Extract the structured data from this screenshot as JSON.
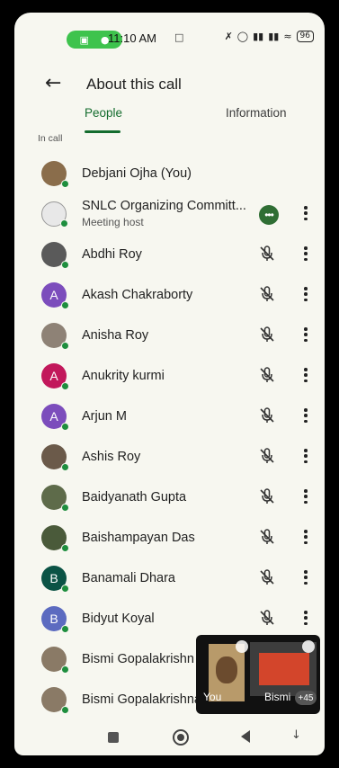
{
  "statusbar": {
    "time": "11:10 AM",
    "battery": "96",
    "recording_icons": [
      "camera-icon",
      "mic-icon"
    ]
  },
  "header": {
    "title": "About this call",
    "back_icon": "arrow-back-icon"
  },
  "tabs": [
    {
      "label": "People",
      "active": true
    },
    {
      "label": "Information",
      "active": false
    }
  ],
  "section_label": "In call",
  "participants": [
    {
      "name": "Debjani Ojha (You)",
      "avatar": "photo",
      "color": "#8a6d4b",
      "status": "",
      "muted": false,
      "host": false,
      "show_more": false
    },
    {
      "name": "SNLC Organizing Committ...",
      "avatar": "logo",
      "color": "#e8e8e8",
      "status": "Meeting host",
      "muted": false,
      "host": true,
      "show_more": true
    },
    {
      "name": "Abdhi Roy",
      "avatar": "photo",
      "color": "#5a5a5a",
      "status": "",
      "muted": true,
      "host": false,
      "show_more": true
    },
    {
      "name": "Akash Chakraborty",
      "avatar": "A",
      "color": "#7c4dbc",
      "status": "",
      "muted": true,
      "host": false,
      "show_more": true
    },
    {
      "name": "Anisha Roy",
      "avatar": "photo",
      "color": "#8e8276",
      "status": "",
      "muted": true,
      "host": false,
      "show_more": true
    },
    {
      "name": "Anukrity kurmi",
      "avatar": "A",
      "color": "#c2185b",
      "status": "",
      "muted": true,
      "host": false,
      "show_more": true
    },
    {
      "name": "Arjun M",
      "avatar": "A",
      "color": "#7c4dbc",
      "status": "",
      "muted": true,
      "host": false,
      "show_more": true
    },
    {
      "name": "Ashis Roy",
      "avatar": "photo",
      "color": "#6b5a4a",
      "status": "",
      "muted": true,
      "host": false,
      "show_more": true
    },
    {
      "name": "Baidyanath Gupta",
      "avatar": "photo",
      "color": "#5e6b4a",
      "status": "",
      "muted": true,
      "host": false,
      "show_more": true
    },
    {
      "name": "Baishampayan Das",
      "avatar": "photo",
      "color": "#4a5a3a",
      "status": "",
      "muted": true,
      "host": false,
      "show_more": true
    },
    {
      "name": "Banamali Dhara",
      "avatar": "B",
      "color": "#0b5345",
      "status": "",
      "muted": true,
      "host": false,
      "show_more": true
    },
    {
      "name": "Bidyut Koyal",
      "avatar": "B",
      "color": "#5c6bc0",
      "status": "",
      "muted": true,
      "host": false,
      "show_more": true
    },
    {
      "name": "Bismi Gopalakrishn",
      "avatar": "photo",
      "color": "#8a7a66",
      "status": "",
      "muted": false,
      "host": false,
      "show_more": false
    },
    {
      "name": "Bismi Gopalakrishnan (T...",
      "avatar": "photo",
      "color": "#8a7a66",
      "status": "",
      "muted": false,
      "host": false,
      "show_more": false
    }
  ],
  "pip": {
    "label_you": "You",
    "label_other": "Bismi",
    "extra_count": "+45"
  },
  "colors": {
    "accent": "#146c2e",
    "online": "#1e8e3e",
    "background": "#f7f7f0"
  }
}
